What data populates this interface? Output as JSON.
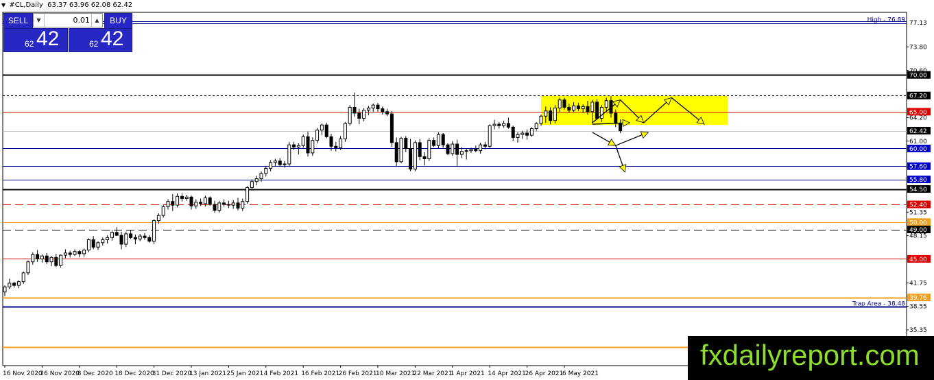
{
  "toolbar": {
    "icon": "triangle-down-icon",
    "symbol": "#CL,Daily",
    "ohlc": "63.37 63.96 62.08 62.42"
  },
  "trade_panel": {
    "sell_label": "SELL",
    "buy_label": "BUY",
    "lot_value": "0.01",
    "sell_small": "62",
    "sell_big": "42",
    "buy_small": "62",
    "buy_big": "42",
    "accent_color": "#2727c4"
  },
  "watermark": {
    "text": "fxdailyreport.com",
    "color": "#8cde2a"
  },
  "chart_data": {
    "type": "candlestick",
    "title": "",
    "y_range": [
      30.5,
      78.5
    ],
    "y_tick_labels": [
      "73.80",
      "70.60",
      "64.20",
      "61.00",
      "51.35",
      "48.15",
      "41.75",
      "38.55",
      "35.35"
    ],
    "x_labels": [
      {
        "label": "16 Nov 2020",
        "index": 0
      },
      {
        "label": "26 Nov 2020",
        "index": 8
      },
      {
        "label": "8 Dec 2020",
        "index": 16
      },
      {
        "label": "18 Dec 2020",
        "index": 24
      },
      {
        "label": "31 Dec 2020",
        "index": 32
      },
      {
        "label": "13 Jan 2021",
        "index": 40
      },
      {
        "label": "25 Jan 2021",
        "index": 48
      },
      {
        "label": "4 Feb 2021",
        "index": 56
      },
      {
        "label": "16 Feb 2021",
        "index": 64
      },
      {
        "label": "26 Feb 2021",
        "index": 72
      },
      {
        "label": "10 Mar 2021",
        "index": 80
      },
      {
        "label": "22 Mar 2021",
        "index": 88
      },
      {
        "label": "1 Apr 2021",
        "index": 96
      },
      {
        "label": "14 Apr 2021",
        "index": 104
      },
      {
        "label": "26 Apr 2021",
        "index": 112
      },
      {
        "label": "6 May 2021",
        "index": 120
      }
    ],
    "levels": [
      {
        "price": 77.13,
        "label": "77.13",
        "color": "#00008b",
        "style": "double",
        "tag_bg": "#ffffff",
        "tag_fg": "#000000",
        "note": "High - 76.89",
        "note_color": "#00008b"
      },
      {
        "price": 70.0,
        "label": "70.00",
        "color": "#000000",
        "style": "solid-thick",
        "tag_bg": "#000000",
        "tag_fg": "#ffffff"
      },
      {
        "price": 67.2,
        "label": "67.20",
        "color": "#000000",
        "style": "dotted",
        "tag_bg": "#000000",
        "tag_fg": "#ffffff"
      },
      {
        "price": 65.0,
        "label": "65.00",
        "color": "#e00000",
        "style": "solid",
        "tag_bg": "#e00000",
        "tag_fg": "#ffffff"
      },
      {
        "price": 62.42,
        "label": "62.42",
        "color": "#c0c0c0",
        "style": "solid",
        "tag_bg": "#000000",
        "tag_fg": "#ffffff"
      },
      {
        "price": 60.0,
        "label": "60.00",
        "color": "#00008b",
        "style": "solid",
        "tag_bg": "#0000cc",
        "tag_fg": "#ffffff"
      },
      {
        "price": 57.6,
        "label": "57.60",
        "color": "#00008b",
        "style": "solid",
        "tag_bg": "#0000cc",
        "tag_fg": "#ffffff"
      },
      {
        "price": 55.8,
        "label": "55.80",
        "color": "#00008b",
        "style": "solid",
        "tag_bg": "#0000cc",
        "tag_fg": "#ffffff"
      },
      {
        "price": 54.5,
        "label": "54.50",
        "color": "#000000",
        "style": "solid-thick",
        "tag_bg": "#000000",
        "tag_fg": "#ffffff"
      },
      {
        "price": 52.4,
        "label": "52.40",
        "color": "#e00000",
        "style": "dashed",
        "tag_bg": "#e00000",
        "tag_fg": "#ffffff"
      },
      {
        "price": 50.0,
        "label": "50.00",
        "color": "#f0a020",
        "style": "solid",
        "tag_bg": "#f0a020",
        "tag_fg": "#ffffff"
      },
      {
        "price": 49.0,
        "label": "49.00",
        "color": "#000000",
        "style": "dashed",
        "tag_bg": "#000000",
        "tag_fg": "#ffffff"
      },
      {
        "price": 45.0,
        "label": "45.00",
        "color": "#e00000",
        "style": "solid",
        "tag_bg": "#e00000",
        "tag_fg": "#ffffff"
      },
      {
        "price": 39.76,
        "label": "39.76",
        "color": "#f0a020",
        "style": "solid-thick",
        "tag_bg": "#f0a020",
        "tag_fg": "#ffffff"
      },
      {
        "price": 38.48,
        "label": "",
        "color": "#00008b",
        "style": "solid-thick",
        "tag_bg": "",
        "tag_fg": "",
        "note": "Trap Area - 38.48",
        "note_color": "#00008b"
      },
      {
        "price": 32.99,
        "label": "32.99",
        "color": "#f0a020",
        "style": "solid-thick",
        "tag_bg": "#f0a020",
        "tag_fg": "#ffffff"
      }
    ],
    "candles": [
      [
        40.5,
        41.4,
        39.9,
        41.2
      ],
      [
        41.2,
        42.3,
        40.9,
        41.7
      ],
      [
        41.7,
        41.9,
        41.1,
        41.4
      ],
      [
        41.4,
        42.1,
        41.0,
        41.9
      ],
      [
        41.9,
        43.3,
        41.6,
        43.1
      ],
      [
        43.1,
        44.8,
        42.8,
        44.6
      ],
      [
        44.6,
        45.9,
        44.2,
        45.6
      ],
      [
        45.6,
        46.2,
        44.6,
        45.0
      ],
      [
        45.0,
        45.6,
        44.5,
        45.4
      ],
      [
        45.4,
        45.8,
        44.3,
        44.6
      ],
      [
        44.6,
        45.4,
        44.0,
        45.2
      ],
      [
        45.2,
        45.7,
        43.9,
        44.1
      ],
      [
        44.1,
        45.6,
        43.8,
        45.5
      ],
      [
        45.5,
        46.3,
        45.1,
        45.8
      ],
      [
        45.8,
        46.1,
        45.2,
        45.6
      ],
      [
        45.6,
        46.3,
        45.4,
        46.0
      ],
      [
        46.0,
        46.2,
        45.2,
        45.7
      ],
      [
        45.7,
        46.4,
        45.3,
        46.2
      ],
      [
        46.2,
        47.8,
        45.9,
        47.6
      ],
      [
        47.6,
        48.1,
        46.3,
        46.6
      ],
      [
        46.6,
        47.4,
        46.2,
        47.2
      ],
      [
        47.2,
        47.9,
        46.8,
        47.6
      ],
      [
        47.6,
        48.2,
        47.1,
        47.9
      ],
      [
        47.9,
        48.9,
        47.5,
        48.6
      ],
      [
        48.6,
        49.3,
        48.1,
        48.2
      ],
      [
        48.2,
        48.7,
        46.3,
        47.0
      ],
      [
        47.0,
        48.7,
        46.6,
        48.4
      ],
      [
        48.4,
        48.9,
        47.7,
        47.9
      ],
      [
        47.9,
        48.3,
        47.0,
        47.7
      ],
      [
        47.7,
        48.4,
        47.4,
        48.1
      ],
      [
        48.1,
        48.5,
        47.6,
        47.9
      ],
      [
        47.9,
        48.2,
        47.2,
        47.4
      ],
      [
        47.4,
        50.4,
        47.0,
        50.2
      ],
      [
        50.2,
        51.2,
        49.8,
        50.9
      ],
      [
        50.9,
        52.3,
        50.6,
        52.1
      ],
      [
        52.1,
        53.1,
        51.7,
        52.8
      ],
      [
        52.8,
        53.8,
        51.5,
        52.3
      ],
      [
        52.3,
        53.9,
        52.0,
        53.5
      ],
      [
        53.5,
        53.9,
        52.8,
        53.2
      ],
      [
        53.2,
        53.7,
        52.9,
        53.4
      ],
      [
        53.4,
        53.6,
        51.7,
        52.2
      ],
      [
        52.2,
        53.1,
        51.8,
        52.7
      ],
      [
        52.7,
        53.2,
        52.2,
        52.5
      ],
      [
        52.5,
        53.6,
        52.1,
        53.3
      ],
      [
        53.3,
        53.5,
        52.2,
        52.4
      ],
      [
        52.4,
        52.9,
        51.3,
        51.6
      ],
      [
        51.6,
        52.9,
        51.3,
        52.6
      ],
      [
        52.6,
        53.1,
        52.1,
        52.4
      ],
      [
        52.4,
        52.9,
        51.9,
        52.3
      ],
      [
        52.3,
        53.0,
        51.8,
        52.6
      ],
      [
        52.6,
        53.3,
        51.6,
        51.9
      ],
      [
        51.9,
        53.2,
        51.5,
        52.8
      ],
      [
        52.8,
        54.9,
        52.5,
        54.7
      ],
      [
        54.7,
        55.8,
        54.3,
        55.5
      ],
      [
        55.5,
        56.3,
        55.0,
        55.9
      ],
      [
        55.9,
        56.9,
        55.5,
        56.6
      ],
      [
        56.6,
        57.6,
        56.2,
        57.3
      ],
      [
        57.3,
        58.4,
        56.9,
        58.1
      ],
      [
        58.1,
        58.6,
        57.6,
        58.3
      ],
      [
        58.3,
        58.7,
        57.6,
        57.8
      ],
      [
        57.8,
        58.3,
        57.4,
        57.9
      ],
      [
        57.9,
        60.9,
        57.6,
        60.5
      ],
      [
        60.5,
        60.9,
        59.8,
        60.2
      ],
      [
        60.2,
        60.7,
        59.2,
        60.4
      ],
      [
        60.4,
        61.9,
        60.1,
        61.6
      ],
      [
        61.6,
        62.3,
        58.9,
        59.4
      ],
      [
        59.4,
        61.5,
        59.0,
        61.1
      ],
      [
        61.1,
        62.8,
        60.7,
        62.5
      ],
      [
        62.5,
        63.4,
        61.8,
        63.2
      ],
      [
        63.2,
        63.5,
        61.4,
        61.6
      ],
      [
        61.6,
        62.0,
        59.7,
        60.3
      ],
      [
        60.3,
        60.9,
        59.6,
        60.1
      ],
      [
        60.1,
        61.7,
        59.8,
        61.3
      ],
      [
        61.3,
        63.6,
        60.9,
        63.4
      ],
      [
        63.4,
        65.9,
        63.1,
        65.6
      ],
      [
        65.6,
        67.6,
        64.3,
        64.8
      ],
      [
        64.8,
        65.4,
        63.3,
        64.1
      ],
      [
        64.1,
        65.5,
        63.7,
        65.2
      ],
      [
        65.2,
        65.8,
        64.5,
        65.5
      ],
      [
        65.5,
        66.1,
        64.9,
        65.9
      ],
      [
        65.9,
        66.2,
        65.0,
        65.4
      ],
      [
        65.4,
        65.7,
        64.6,
        65.0
      ],
      [
        65.0,
        65.4,
        64.4,
        64.7
      ],
      [
        64.7,
        65.1,
        60.2,
        60.8
      ],
      [
        60.8,
        61.5,
        57.6,
        58.2
      ],
      [
        58.2,
        61.6,
        58.0,
        61.4
      ],
      [
        61.4,
        61.7,
        59.5,
        60.0
      ],
      [
        60.0,
        61.3,
        56.9,
        57.2
      ],
      [
        57.2,
        61.1,
        56.9,
        60.8
      ],
      [
        60.8,
        61.3,
        58.4,
        58.9
      ],
      [
        58.9,
        59.5,
        57.7,
        58.6
      ],
      [
        58.6,
        61.4,
        58.3,
        61.1
      ],
      [
        61.1,
        61.5,
        60.2,
        60.4
      ],
      [
        60.4,
        62.2,
        60.0,
        61.9
      ],
      [
        61.9,
        62.1,
        60.1,
        60.5
      ],
      [
        60.5,
        60.7,
        59.1,
        59.3
      ],
      [
        59.3,
        61.0,
        59.0,
        60.6
      ],
      [
        60.6,
        61.2,
        57.6,
        59.2
      ],
      [
        59.2,
        60.2,
        58.7,
        59.6
      ],
      [
        59.6,
        60.0,
        58.5,
        59.7
      ],
      [
        59.7,
        60.1,
        59.4,
        59.9
      ],
      [
        59.9,
        60.4,
        59.5,
        59.7
      ],
      [
        59.7,
        60.8,
        59.3,
        60.5
      ],
      [
        60.5,
        60.9,
        59.9,
        60.3
      ],
      [
        60.3,
        63.3,
        60.1,
        63.1
      ],
      [
        63.1,
        63.9,
        62.6,
        63.3
      ],
      [
        63.3,
        63.6,
        62.7,
        63.1
      ],
      [
        63.1,
        63.8,
        62.8,
        63.4
      ],
      [
        63.4,
        64.2,
        62.7,
        62.9
      ],
      [
        62.9,
        63.1,
        61.0,
        61.5
      ],
      [
        61.5,
        62.2,
        60.8,
        61.9
      ],
      [
        61.9,
        62.4,
        61.3,
        62.1
      ],
      [
        62.1,
        62.6,
        61.2,
        61.8
      ],
      [
        61.8,
        62.9,
        61.6,
        62.7
      ],
      [
        62.7,
        63.6,
        62.4,
        63.4
      ],
      [
        63.4,
        64.6,
        63.1,
        64.4
      ],
      [
        64.4,
        65.7,
        63.5,
        65.1
      ],
      [
        65.1,
        65.6,
        63.3,
        63.8
      ],
      [
        63.8,
        65.9,
        63.4,
        65.5
      ],
      [
        65.5,
        66.9,
        64.9,
        66.6
      ],
      [
        66.6,
        66.9,
        65.3,
        65.6
      ],
      [
        65.6,
        66.1,
        64.8,
        65.2
      ],
      [
        65.2,
        66.3,
        64.9,
        65.8
      ],
      [
        65.8,
        66.2,
        65.1,
        65.4
      ],
      [
        65.4,
        66.0,
        64.8,
        65.7
      ],
      [
        65.7,
        66.5,
        64.6,
        65.0
      ],
      [
        65.0,
        66.6,
        63.4,
        66.3
      ],
      [
        66.3,
        66.7,
        63.9,
        64.1
      ],
      [
        64.1,
        65.9,
        63.6,
        65.6
      ],
      [
        65.6,
        66.9,
        65.1,
        66.5
      ],
      [
        66.5,
        67.1,
        64.2,
        64.8
      ],
      [
        64.8,
        65.3,
        62.9,
        63.4
      ],
      [
        63.4,
        63.96,
        62.08,
        62.42
      ]
    ],
    "highlight_box": {
      "index_start": 115,
      "index_end": 155,
      "price_low": 63.2,
      "price_high": 67.2,
      "color": "#ffff00"
    },
    "forecast_arrows": [
      {
        "from": [
          126,
          63.5
        ],
        "to": [
          132,
          66.6
        ]
      },
      {
        "from": [
          132,
          66.6
        ],
        "to": [
          137,
          63.5
        ]
      },
      {
        "from": [
          137,
          63.5
        ],
        "to": [
          143,
          66.9
        ]
      },
      {
        "from": [
          143,
          66.9
        ],
        "to": [
          150,
          63.3
        ]
      },
      {
        "from": [
          126,
          63.3
        ],
        "to": [
          134,
          63.5
        ]
      },
      {
        "from": [
          126,
          62.2
        ],
        "to": [
          131,
          60.4
        ]
      },
      {
        "from": [
          131,
          60.4
        ],
        "to": [
          138,
          62.2
        ]
      },
      {
        "from": [
          131,
          60.4
        ],
        "to": [
          133,
          56.8
        ]
      }
    ],
    "arrow_color": "#ffff00"
  }
}
